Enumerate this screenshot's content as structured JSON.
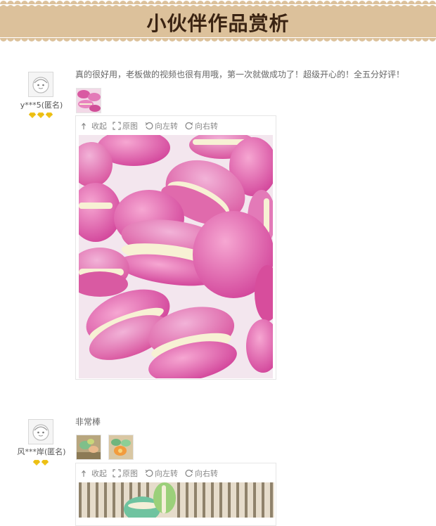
{
  "banner": {
    "title": "小伙伴作品赏析",
    "bg_color": "#dcc19b",
    "title_color": "#3b2413"
  },
  "viewer_toolbar": {
    "collapse": "收起",
    "original": "原图",
    "rotate_left": "向左转",
    "rotate_right": "向右转"
  },
  "reviews": [
    {
      "username": "y***5(匿名)",
      "level_icons": [
        "diamond-icon",
        "diamond-icon",
        "diamond-icon"
      ],
      "text": "真的很好用，老板做的视频也很有用哦，第一次就做成功了！超级开心的！全五分好评！",
      "thumbnails": [
        "pink-macarons-thumbnail"
      ],
      "photo": "pink-macarons-photo"
    },
    {
      "username": "风***岸(匿名)",
      "level_icons": [
        "diamond-icon",
        "diamond-icon"
      ],
      "text": "非常棒",
      "thumbnails": [
        "macarons-thumbnail-1",
        "macarons-thumbnail-2"
      ],
      "photo": "green-macarons-photo"
    }
  ],
  "colors": {
    "diamond": "#f0c419",
    "macaron_pink": "#e56ab0",
    "filling_cream": "#f7f1d4"
  }
}
